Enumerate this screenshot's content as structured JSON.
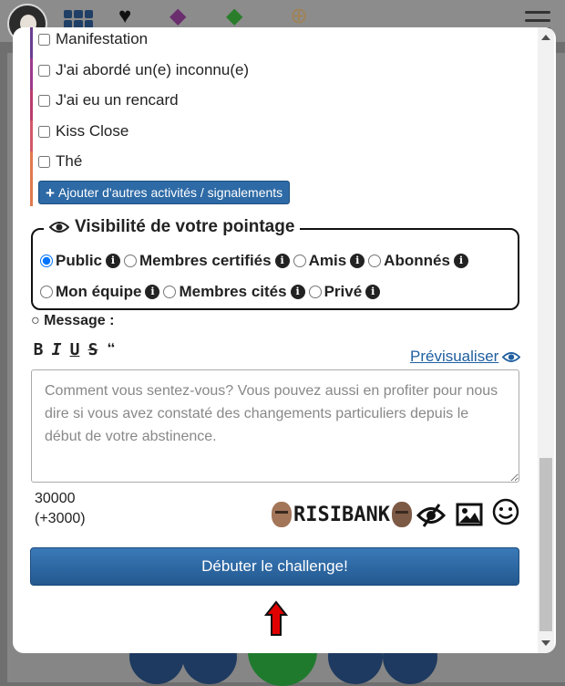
{
  "activities": [
    {
      "label": "Manifestation",
      "checked": false,
      "color": "#6b3d8f"
    },
    {
      "label": "J'ai abordé un(e) inconnu(e)",
      "checked": false,
      "color": "#9b3b8a"
    },
    {
      "label": "J'ai eu un rencard",
      "checked": false,
      "color": "#b83d6e"
    },
    {
      "label": "Kiss Close",
      "checked": false,
      "color": "#d2586a"
    },
    {
      "label": "Thé",
      "checked": false,
      "color": "#e0794f"
    }
  ],
  "add_activities_label": "Ajouter d'autres activités / signalements",
  "visibility": {
    "title": "Visibilité de votre pointage",
    "selected": "Public",
    "options": [
      "Public",
      "Membres certifiés",
      "Amis",
      "Abonnés",
      "Mon équipe",
      "Membres cités",
      "Privé"
    ]
  },
  "message": {
    "label": "○ Message :",
    "format_buttons": [
      "B",
      "I",
      "U",
      "S",
      "❝"
    ],
    "preview_label": "Prévisualiser",
    "placeholder": "Comment vous sentez-vous? Vous pouvez aussi en profiter pour nous dire si vous avez constaté des changements particuliers depuis le début de votre abstinence.",
    "counter": "30000",
    "counter_bonus": "(+3000)"
  },
  "media_toolbar": {
    "risibank_label": "RISIBANK",
    "icons": [
      "eye-slash-icon",
      "image-icon",
      "smiley-icon"
    ]
  },
  "submit_label": "Débuter le challenge!",
  "colors": {
    "primary": "#2d6aa6",
    "arrow": "#e00000"
  }
}
